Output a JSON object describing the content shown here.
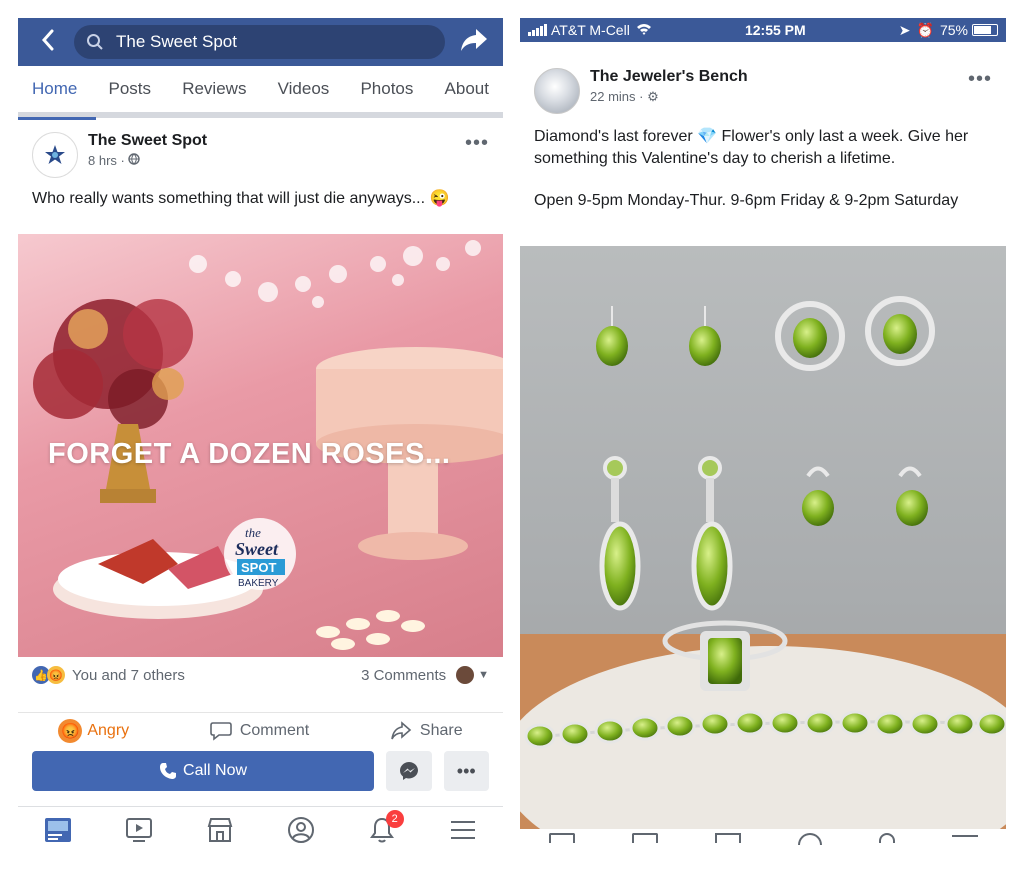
{
  "left": {
    "search_text": "The Sweet Spot",
    "tabs": [
      "Home",
      "Posts",
      "Reviews",
      "Videos",
      "Photos",
      "About"
    ],
    "post": {
      "page_name": "The Sweet Spot",
      "time": "8 hrs ·",
      "text": "Who really wants something that will just die anyways... 😜",
      "image_overlay": "FORGET A DOZEN ROSES...",
      "logo_text": [
        "the",
        "Sweet",
        "SPOT",
        "BAKERY"
      ]
    },
    "reactions_summary": "You and 7 others",
    "comments_count": "3 Comments",
    "actions": {
      "angry": "Angry",
      "comment": "Comment",
      "share": "Share"
    },
    "call_now": "Call Now",
    "notification_badge": "2"
  },
  "right": {
    "status": {
      "carrier": "AT&T M-Cell",
      "time": "12:55 PM",
      "battery": "75%"
    },
    "post": {
      "page_name": "The Jeweler's Bench",
      "time": "22 mins ·",
      "text_line1": "Diamond's  last forever 💎 Flower's  only last a week. Give her something  this Valentine's  day to cherish a lifetime.",
      "text_line2": "Open 9-5pm Monday-Thur. 9-6pm Friday & 9-2pm Saturday"
    }
  },
  "colors": {
    "fb_blue": "#3b5998",
    "accent": "#4267b2",
    "angry": "#e9710f",
    "badge": "#fa3e3e"
  }
}
